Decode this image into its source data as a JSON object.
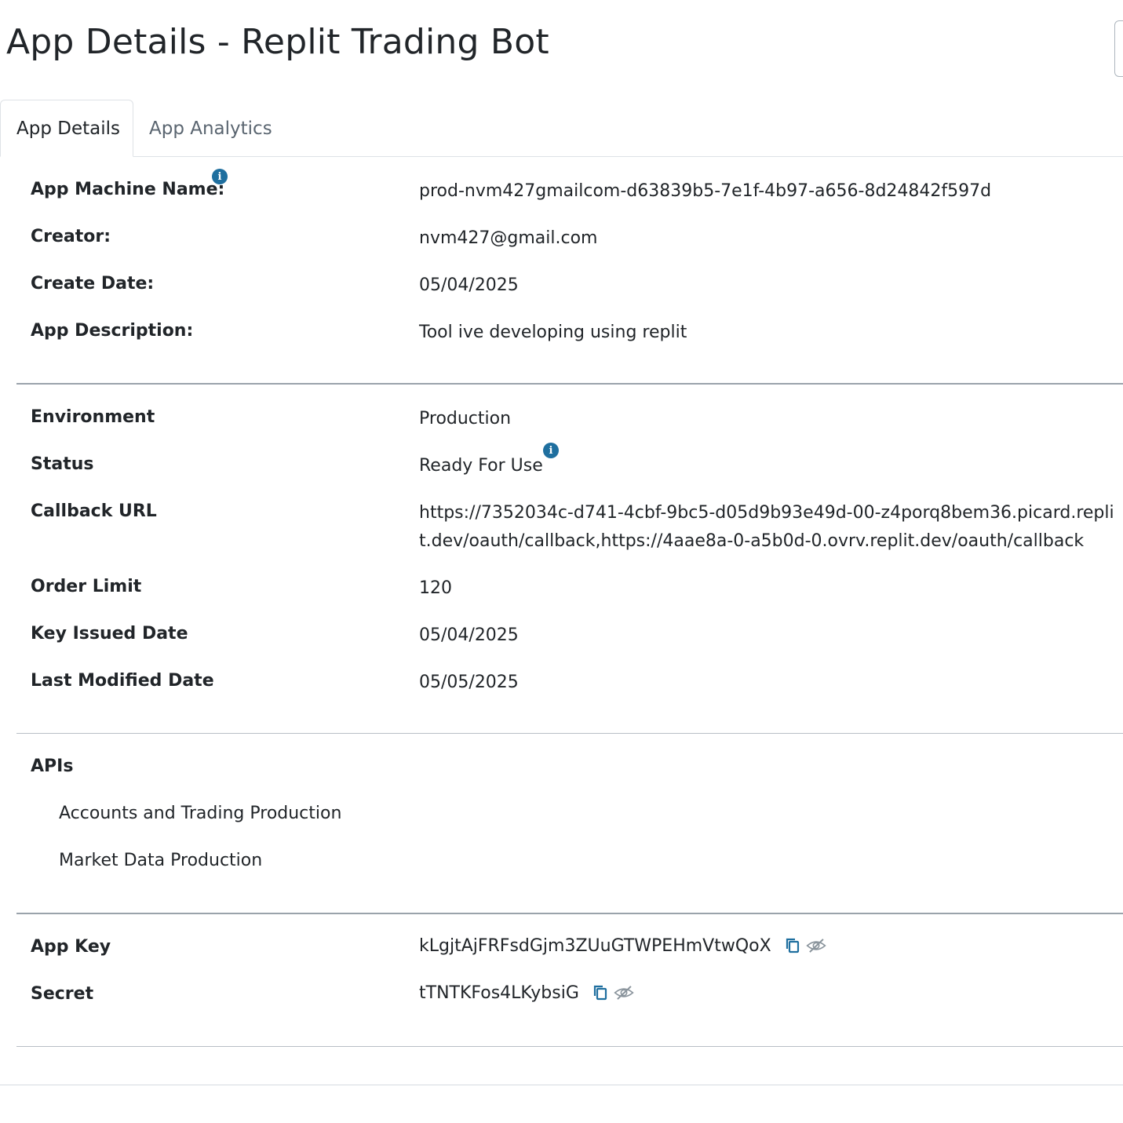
{
  "header": {
    "title": "App Details - Replit Trading Bot"
  },
  "tabs": [
    {
      "label": "App Details",
      "active": true
    },
    {
      "label": "App Analytics",
      "active": false
    }
  ],
  "details": {
    "machine_name_label": "App Machine Name:",
    "machine_name_value": "prod-nvm427gmailcom-d63839b5-7e1f-4b97-a656-8d24842f597d",
    "creator_label": "Creator:",
    "creator_value": "nvm427@gmail.com",
    "create_date_label": "Create Date:",
    "create_date_value": "05/04/2025",
    "description_label": "App Description:",
    "description_value": "Tool ive developing using replit"
  },
  "config": {
    "environment_label": "Environment",
    "environment_value": "Production",
    "status_label": "Status",
    "status_value": "Ready For Use",
    "callback_label": "Callback URL",
    "callback_value": "https://7352034c-d741-4cbf-9bc5-d05d9b93e49d-00-z4porq8bem36.picard.replit.dev/oauth/callback,https://4aae8a-0-a5b0d-0.ovrv.replit.dev/oauth/callback",
    "order_limit_label": "Order Limit",
    "order_limit_value": "120",
    "key_issued_label": "Key Issued Date",
    "key_issued_value": "05/04/2025",
    "last_modified_label": "Last Modified Date",
    "last_modified_value": "05/05/2025"
  },
  "apis": {
    "heading": "APIs",
    "items": [
      "Accounts and Trading Production",
      "Market Data Production"
    ]
  },
  "credentials": {
    "app_key_label": "App Key",
    "app_key_value": "kLgjtAjFRFsdGjm3ZUuGTWPEHmVtwQoX",
    "secret_label": "Secret",
    "secret_value": "tTNTKFos4LKybsiG"
  },
  "icons": {
    "info": "info-icon",
    "copy": "copy-icon",
    "visibility": "eye-off-icon"
  },
  "colors": {
    "info_icon": "#1f6f9f",
    "copy_icon": "#1f6f9f",
    "eye_icon": "#8a949c"
  }
}
